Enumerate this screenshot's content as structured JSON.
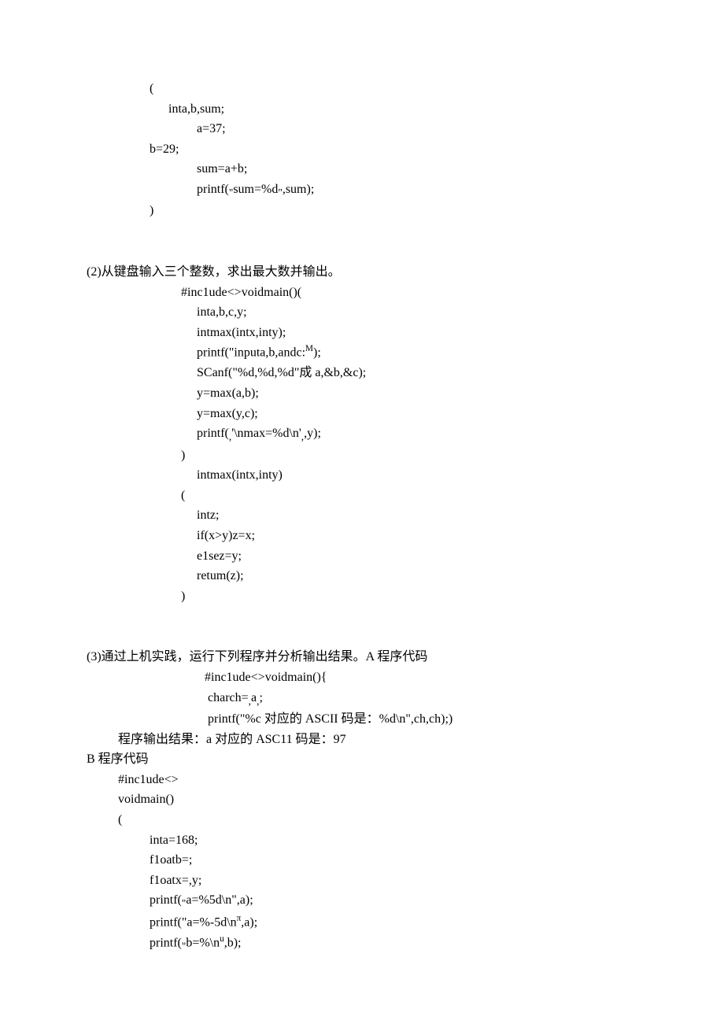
{
  "block1": {
    "l1": "(",
    "l2": " inta,b,sum;",
    "l3": "a=37;",
    "l4": "b=29;",
    "l5": "sum=a+b;",
    "l6_a": "printf(",
    "l6_b": "sum=%d",
    "l6_c": ",sum);",
    "l7": ")"
  },
  "block2": {
    "title": "(2)从键盘输入三个整数，求出最大数并输出。",
    "l1": "#inc1ude<>voidmain()(",
    "l2": "inta,b,c,y;",
    "l3": "intmax(intx,inty);",
    "l4_a": "printf(\"inputa,b,andc:",
    "l4_b": "M",
    "l4_c": ");",
    "l5": "SCanf(\"%d,%d,%d\"成 a,&b,&c);",
    "l6": "y=max(a,b);",
    "l7": "y=max(y,c);",
    "l8_a": "printf(",
    "l8_b": "'\\nmax=%d\\n'",
    "l8_c": ",y);",
    "l9": ")",
    "l10": "intmax(intx,inty)",
    "l11": "(",
    "l12": "intz;",
    "l13": "if(x>y)z=x;",
    "l14": "e1sez=y;",
    "l15": "retum(z);",
    "l16": ")"
  },
  "block3": {
    "title": "(3)通过上机实践，运行下列程序并分析输出结果。A 程序代码",
    "l1": "#inc1ude<>voidmain(){",
    "l2_a": " charch=",
    "l2_b": "a",
    "l2_c": ";",
    "l3": " printf(\"%c 对应的 ASCII 码是：%d\\n\",ch,ch);)",
    "result": "程序输出结果：a 对应的 ASC11 码是：97",
    "btitle": "B 程序代码",
    "b1": "#inc1ude<>",
    "b2": "voidmain()",
    "b3": "(",
    "b4": "inta=168;",
    "b5": "f1oatb=;",
    "b6": "f1oatx=,y;",
    "b7_a": "printf(",
    "b7_b": "a=%5d\\n\",a);",
    "b8_a": "printf(\"a=%-5d\\n",
    "b8_b": "π",
    "b8_c": ",a);",
    "b9_a": "printf(",
    "b9_b": "b=%\\n",
    "b9_c": "u",
    "b9_d": ",b);"
  }
}
